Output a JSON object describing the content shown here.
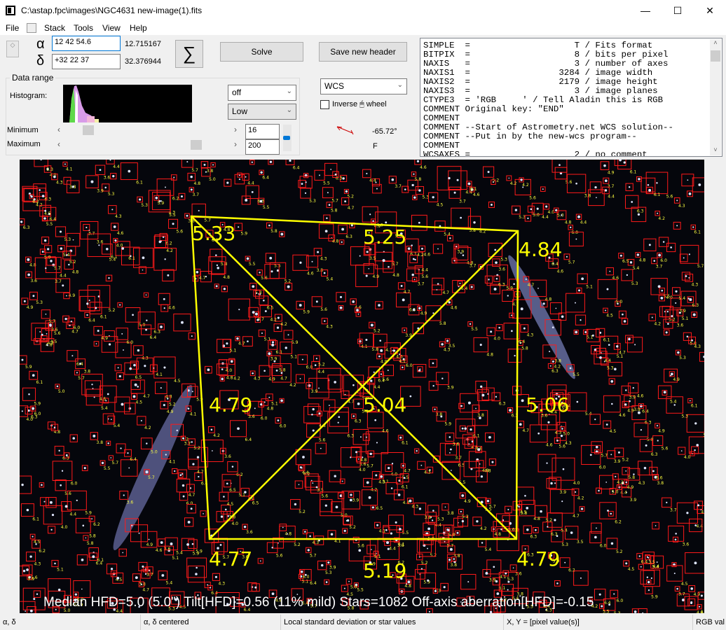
{
  "window": {
    "title": "C:\\astap.fpc\\images\\NGC4631 new-image(1).fits",
    "minimize": "—",
    "maximize": "☐",
    "close": "✕"
  },
  "menu": [
    "File",
    "Stack",
    "Tools",
    "View",
    "Help"
  ],
  "coords": {
    "alpha_symbol": "α",
    "delta_symbol": "δ",
    "ra_value": "12 42 54.6",
    "ra_decimal": "12.715167",
    "dec_value": "+32 22 37",
    "dec_decimal": "32.376944",
    "sigma": "∑"
  },
  "buttons": {
    "solve": "Solve",
    "save_header": "Save new header"
  },
  "data_range": {
    "title": "Data range",
    "histogram_label": "Histogram:",
    "stretch": "off",
    "level": "Low",
    "minimum_label": "Minimum",
    "maximum_label": "Maximum",
    "minimum_value": "16",
    "maximum_value": "200",
    "minimum_slider": 0.08,
    "maximum_slider": 0.78
  },
  "wcs": {
    "mode": "WCS",
    "inverse_wheel": "Inverse 🖱 wheel",
    "inverse_checked": false,
    "angle": "-65.72°",
    "flip": "F"
  },
  "fits_header": [
    "SIMPLE  =                    T / Fits format",
    "BITPIX  =                    8 / bits per pixel",
    "NAXIS   =                    3 / number of axes",
    "NAXIS1  =                 3284 / image width",
    "NAXIS2  =                 2179 / image height",
    "NAXIS3  =                    3 / image planes",
    "CTYPE3  = 'RGB     ' / Tell Aladin this is RGB",
    "COMMENT Original key: \"END\"",
    "COMMENT",
    "COMMENT --Start of Astrometry.net WCS solution--",
    "COMMENT --Put in by the new-wcs program--",
    "COMMENT",
    "WCSAXES =                    2 / no comment"
  ],
  "tilt": {
    "color": "#ffff00",
    "star_box_color": "#ff1a1a",
    "hfd": {
      "top_left": "5.33",
      "top": "5.25",
      "top_right": "4.84",
      "left": "4.79",
      "center": "5.04",
      "right": "5.06",
      "bottom_left": "4.77",
      "bottom": "5.19",
      "bottom_right": "4.79"
    }
  },
  "hfd_info": "Median HFD=5.0 (5.0\")  Tilt[HFD]=0.56 (11% mild)  Stars=1082  Off-axis aberration[HFD]=-0.15",
  "statusbar": [
    "α, δ",
    "α, δ centered",
    "Local standard deviation or star values",
    "X, Y = [pixel value(s)]",
    "RGB val"
  ]
}
